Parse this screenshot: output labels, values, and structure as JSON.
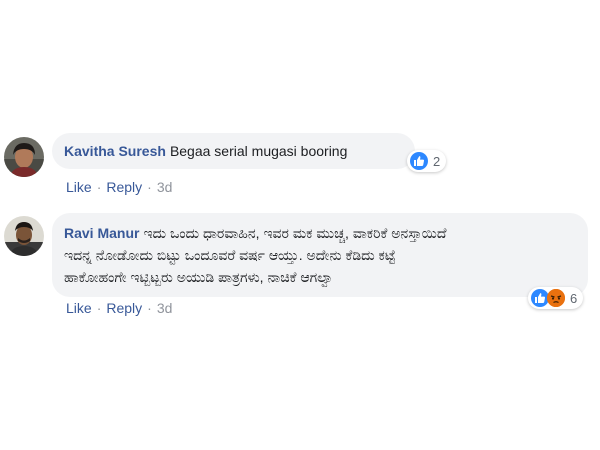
{
  "comments": [
    {
      "author": "Kavitha Suresh",
      "text": "Begaa serial mugasi booring",
      "reactions": {
        "icons": [
          "like-icon"
        ],
        "count": "2"
      },
      "actions": {
        "like": "Like",
        "reply": "Reply",
        "time": "3d"
      },
      "separator": "·"
    },
    {
      "author": "Ravi Manur",
      "text_lines": [
        "ಇದು ಒಂದು ಧಾರವಾಹಿನ, ಇವರ ಮಕ ಮುಚ್ಚ, ವಾಕರಿಕೆ ಅನಸ್ತಾಯಿದೆ",
        "ಇದನ್ನ ನೋಡೋದು ಬಿಟ್ಟು ಒಂದೂವರೆ ವರ್ಷ ಆಯ್ತು. ಅದೇನು ಕೆಡಿದು ಕಟ್ಟೆ",
        "ಹಾಕೋಹಂಗೇ ಇಟ್ಬಿಟ್ಬರು ಅಯುಡಿ ಪಾತ್ರಗಳು, ನಾಚಿಕೆ ಆಗಲ್ವಾ"
      ],
      "reactions": {
        "icons": [
          "like-icon",
          "angry-icon"
        ],
        "count": "6"
      },
      "actions": {
        "like": "Like",
        "reply": "Reply",
        "time": "3d"
      },
      "separator": "·"
    }
  ],
  "colors": {
    "author": "#385898",
    "bubble": "#f2f3f5",
    "like_blue": "#2d88ff",
    "angry_orange": "#e9710f",
    "meta_gray": "#90949c"
  }
}
